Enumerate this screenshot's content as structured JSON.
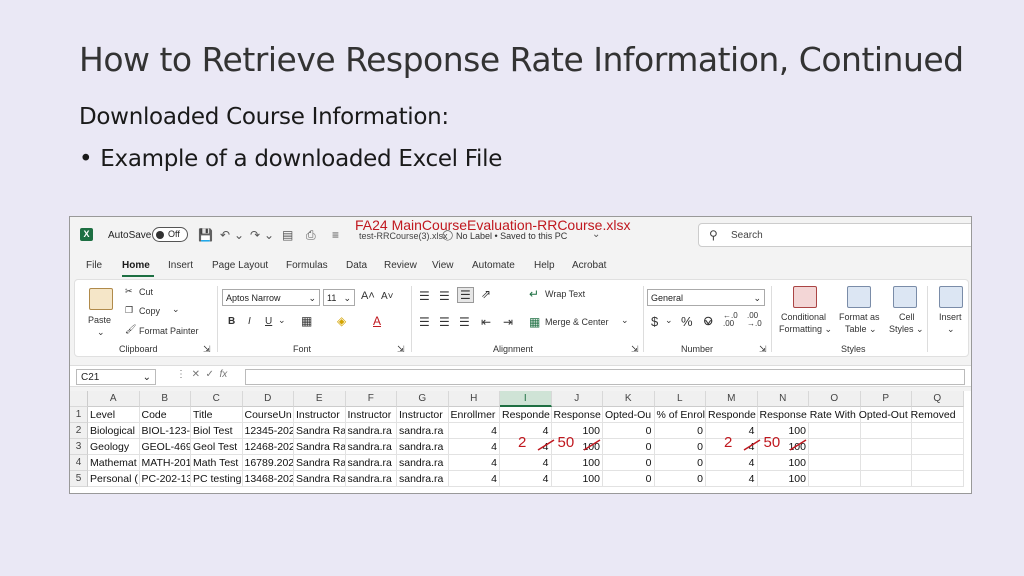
{
  "slide": {
    "title": "How to Retrieve Response Rate Information, Continued",
    "subtitle": "Downloaded Course Information:",
    "bullet": "Example of a downloaded Excel File"
  },
  "excel": {
    "autosave_label": "AutoSave",
    "autosave_state": "Off",
    "file_name_annotation": "FA24 MainCourseEvaluation-RRCourse.xlsx",
    "file_name_original": "test-RRCourse(3).xlsx",
    "label_info": "No Label • Saved to this PC",
    "search_placeholder": "Search",
    "menu": [
      "File",
      "Home",
      "Insert",
      "Page Layout",
      "Formulas",
      "Data",
      "Review",
      "View",
      "Automate",
      "Help",
      "Acrobat"
    ],
    "ribbon": {
      "paste": "Paste",
      "cut": "Cut",
      "copy": "Copy",
      "format_painter": "Format Painter",
      "clipboard": "Clipboard",
      "font_name": "Aptos Narrow",
      "font_size": "11",
      "font_group": "Font",
      "wrap_text": "Wrap Text",
      "merge_center": "Merge & Center",
      "alignment_group": "Alignment",
      "number_format": "General",
      "number_group": "Number",
      "conditional_formatting_1": "Conditional",
      "conditional_formatting_2": "Formatting",
      "format_as_table_1": "Format as",
      "format_as_table_2": "Table",
      "cell_styles_1": "Cell",
      "cell_styles_2": "Styles",
      "styles_group": "Styles",
      "insert": "Insert"
    },
    "name_box": "C21",
    "fx": "fx",
    "columns": [
      "A",
      "B",
      "C",
      "D",
      "E",
      "F",
      "G",
      "H",
      "I",
      "J",
      "K",
      "L",
      "M",
      "N",
      "O",
      "P",
      "Q"
    ],
    "rows": [
      [
        "Level",
        "Code",
        "Title",
        "CourseUn",
        "Instructor",
        "Instructor",
        "Instructor",
        "Enrollmer",
        "Responde",
        "Response",
        "Opted-Ou",
        "% of Enrol",
        "Responde",
        "Response Rate With Opted-Out Removed",
        "",
        "",
        ""
      ],
      [
        "Biological",
        "BIOL-123-",
        "Biol Test",
        "12345-202",
        "Sandra Ra",
        "sandra.ra",
        "sandra.ra",
        "4",
        "4",
        "100",
        "0",
        "0",
        "4",
        "100",
        "",
        "",
        ""
      ],
      [
        "Geology",
        "GEOL-469-",
        "Geol Test",
        "12468-202",
        "Sandra Ra",
        "sandra.ra",
        "sandra.ra",
        "4",
        "4",
        "100",
        "0",
        "0",
        "4",
        "100",
        "",
        "",
        ""
      ],
      [
        "Mathemat",
        "MATH-201",
        "Math Test",
        "16789.202",
        "Sandra Ra",
        "sandra.ra",
        "sandra.ra",
        "4",
        "4",
        "100",
        "0",
        "0",
        "4",
        "100",
        "",
        "",
        ""
      ],
      [
        "Personal (",
        "PC-202-13",
        "PC testing",
        "13468-202",
        "Sandra Ra",
        "sandra.ra",
        "sandra.ra",
        "4",
        "4",
        "100",
        "0",
        "0",
        "4",
        "100",
        "",
        "",
        ""
      ]
    ],
    "annotations": [
      "2",
      "50",
      "2",
      "50"
    ],
    "colors": {
      "accent": "#1d6f42",
      "annotation_red": "#c0181f"
    }
  }
}
